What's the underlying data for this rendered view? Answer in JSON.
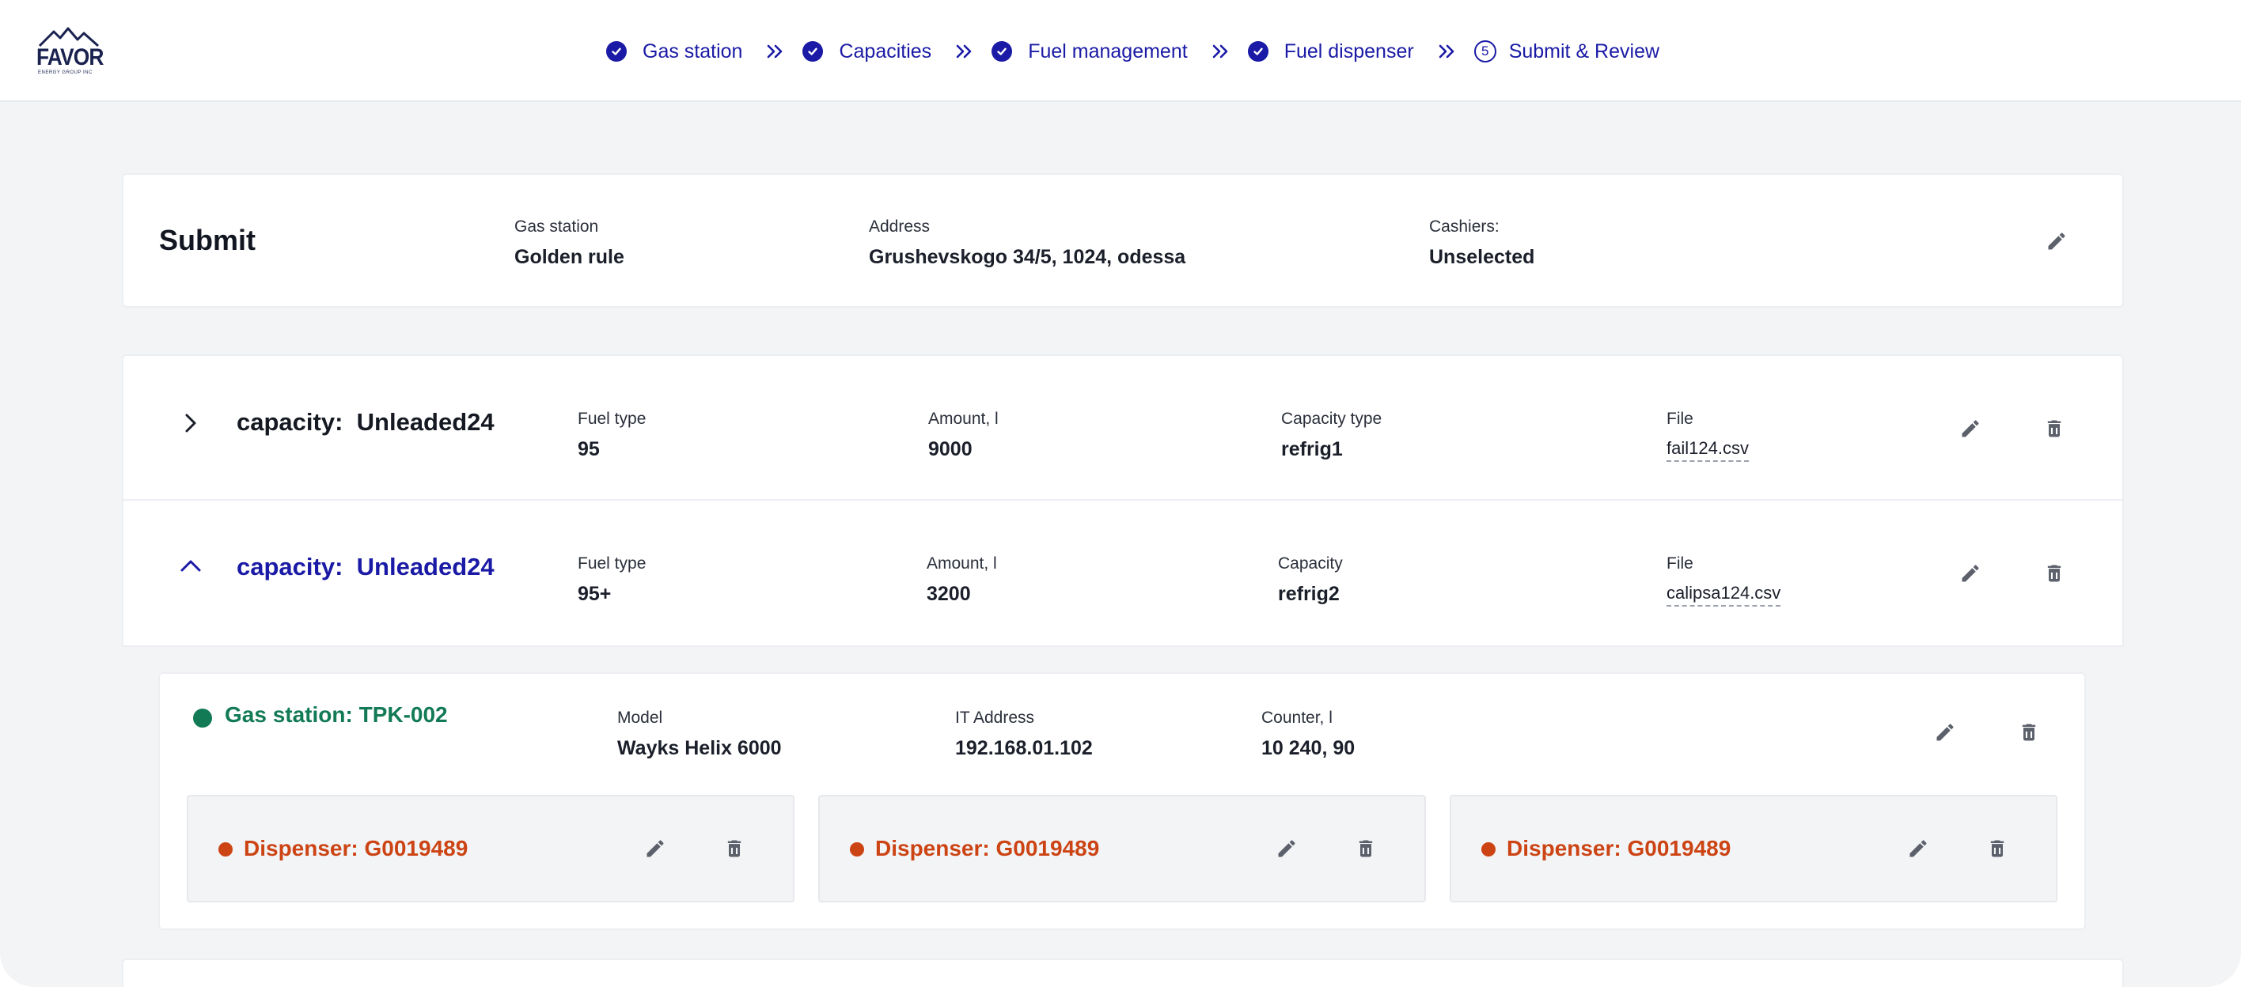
{
  "brand": {
    "logo_text": "FAVOR",
    "logo_sub": "ENERGY GROUP INC"
  },
  "stepper": [
    {
      "label": "Gas station",
      "state": "done"
    },
    {
      "label": "Capacities",
      "state": "done"
    },
    {
      "label": "Fuel management",
      "state": "done"
    },
    {
      "label": "Fuel dispenser",
      "state": "done"
    },
    {
      "label": "Submit & Review",
      "state": "current",
      "number": "5"
    }
  ],
  "submit": {
    "title": "Submit",
    "gas_station_label": "Gas station",
    "gas_station_value": "Golden rule",
    "address_label": "Address",
    "address_value": "Grushevskogo 34/5, 1024, odessa",
    "cashiers_label": "Cashiers:",
    "cashiers_value": "Unselected"
  },
  "capacities": [
    {
      "title_prefix": "capacity:",
      "title_name": "Unleaded24",
      "expanded": false,
      "fuel_type_label": "Fuel type",
      "fuel_type_value": "95",
      "amount_label": "Amount, l",
      "amount_value": "9000",
      "capacity_label": "Capacity type",
      "capacity_value": "refrig1",
      "file_label": "File",
      "file_value": "fail124.csv"
    },
    {
      "title_prefix": "capacity:",
      "title_name": "Unleaded24",
      "expanded": true,
      "fuel_type_label": "Fuel type",
      "fuel_type_value": "95+",
      "amount_label": "Amount, l",
      "amount_value": "3200",
      "capacity_label": "Capacity",
      "capacity_value": "refrig2",
      "file_label": "File",
      "file_value": "calipsa124.csv"
    }
  ],
  "gas_station_detail": {
    "title": "Gas station: TPK-002",
    "model_label": "Model",
    "model_value": "Wayks Helix 6000",
    "ip_label": "IT Address",
    "ip_value": "192.168.01.102",
    "counter_label": "Counter, l",
    "counter_value": "10 240, 90",
    "status_color": "#127a55"
  },
  "dispensers": [
    {
      "title": "Dispenser: G0019489"
    },
    {
      "title": "Dispenser: G0019489"
    },
    {
      "title": "Dispenser: G0019489"
    }
  ],
  "colors": {
    "accent": "#1a1aa6",
    "success": "#127a55",
    "warning": "#cc4414",
    "icon": "#5b606b"
  },
  "icons": {
    "edit": "pencil-icon",
    "delete": "trash-icon",
    "step_done": "check-circle-icon",
    "separator": "double-chevron-right-icon",
    "collapsed": "chevron-right-icon",
    "expanded": "chevron-up-icon"
  }
}
